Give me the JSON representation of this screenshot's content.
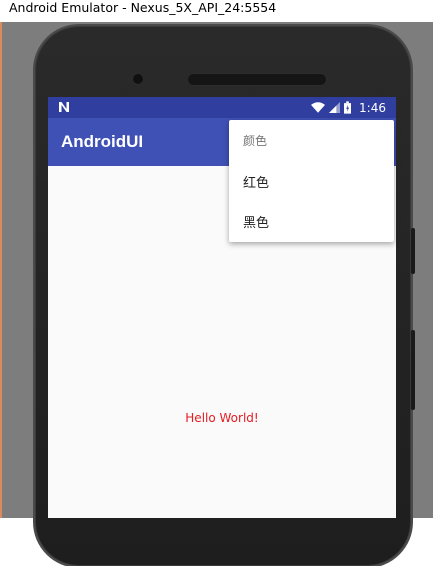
{
  "window": {
    "title": "Android Emulator - Nexus_5X_API_24:5554"
  },
  "status_bar": {
    "time": "1:46",
    "notification_icon": "n-icon",
    "wifi_icon": "wifi-icon",
    "signal_icon": "signal-icon",
    "battery_icon": "battery-icon"
  },
  "app": {
    "title": "AndroidUI",
    "content_text": "Hello World!"
  },
  "menu": {
    "header": "颜色",
    "items": [
      {
        "label": "红色"
      },
      {
        "label": "黑色"
      }
    ]
  },
  "colors": {
    "status_bar": "#303f9f",
    "app_bar": "#3f51b5",
    "content_text": "#e51c23",
    "screen_bg": "#fafafa"
  }
}
